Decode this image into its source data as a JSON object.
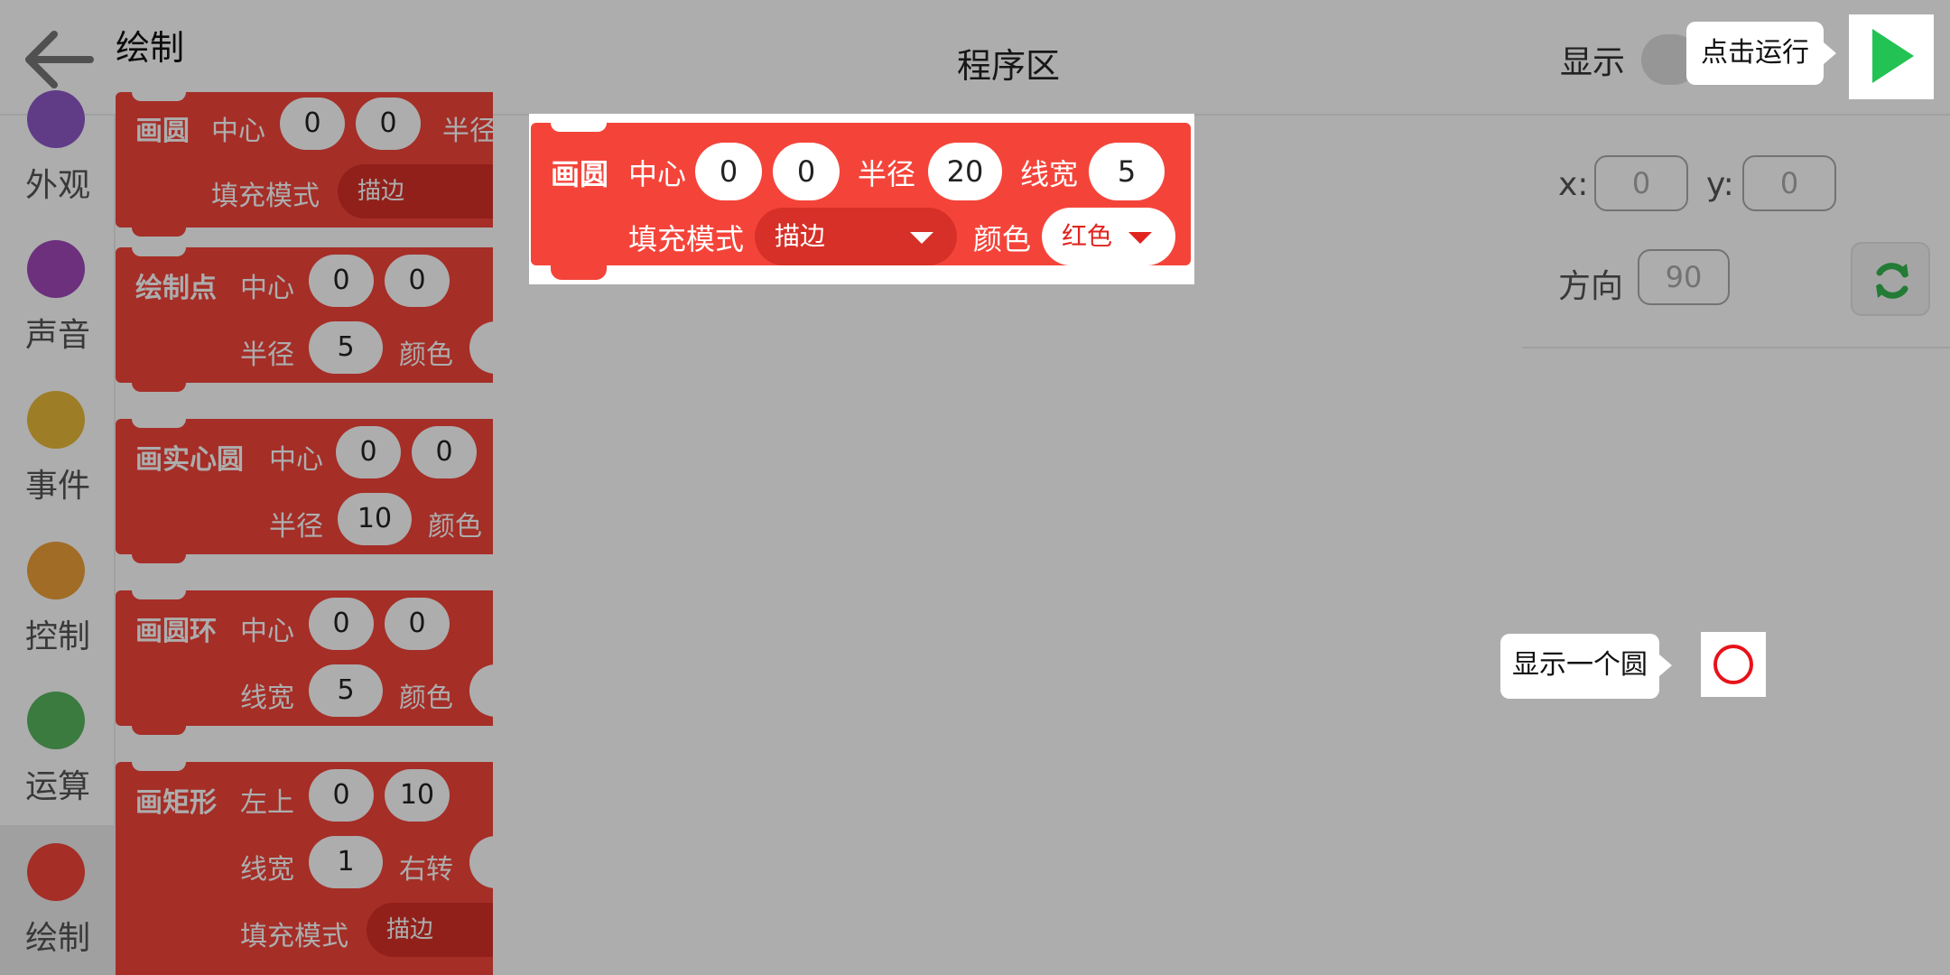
{
  "app": {
    "drawer_title": "绘制",
    "program_area_title": "程序区"
  },
  "categories": [
    {
      "label": "外观",
      "color": "#8e59c7"
    },
    {
      "label": "声音",
      "color": "#9f48b8"
    },
    {
      "label": "事件",
      "color": "#e8b839"
    },
    {
      "label": "控制",
      "color": "#eea038"
    },
    {
      "label": "运算",
      "color": "#58b65f"
    },
    {
      "label": "绘制",
      "color": "#f4443a"
    }
  ],
  "palette": {
    "circle": {
      "name": "画圆",
      "center_label": "中心",
      "cx": "0",
      "cy": "0",
      "radius_label": "半径",
      "fill_label": "填充模式",
      "fill_value": "描边"
    },
    "point": {
      "name": "绘制点",
      "center_label": "中心",
      "cx": "0",
      "cy": "0",
      "radius_label": "半径",
      "radius": "5",
      "color_label": "颜色"
    },
    "solid_circle": {
      "name": "画实心圆",
      "center_label": "中心",
      "cx": "0",
      "cy": "0",
      "radius_label": "半径",
      "radius": "10",
      "color_label": "颜色"
    },
    "ring": {
      "name": "画圆环",
      "center_label": "中心",
      "cx": "0",
      "cy": "0",
      "width_label": "线宽",
      "width": "5",
      "color_label": "颜色"
    },
    "rect": {
      "name": "画矩形",
      "topleft_label": "左上",
      "x": "0",
      "y": "10",
      "width_label": "线宽",
      "width": "1",
      "rotate_label": "右转",
      "fill_label": "填充模式",
      "fill_value": "描边"
    }
  },
  "program_block": {
    "name": "画圆",
    "center_label": "中心",
    "cx": "0",
    "cy": "0",
    "radius_label": "半径",
    "radius": "20",
    "line_width_label": "线宽",
    "line_width": "5",
    "fill_label": "填充模式",
    "fill_value": "描边",
    "color_label": "颜色",
    "color_value": "红色"
  },
  "stage": {
    "show_label": "显示",
    "x_label": "x:",
    "x_value": "0",
    "y_label": "y:",
    "y_value": "0",
    "direction_label": "方向",
    "direction_value": "90"
  },
  "tooltips": {
    "run": "点击运行",
    "result": "显示一个圆"
  },
  "colors": {
    "block_red": "#f4443a",
    "run_green": "#23c254",
    "circle_red": "#e8121a"
  }
}
